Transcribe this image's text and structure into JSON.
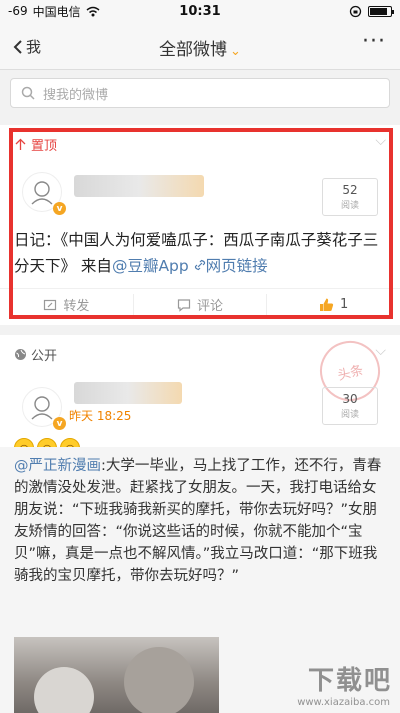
{
  "statusbar": {
    "signal": "-69",
    "carrier": "中国电信",
    "time": "10:31",
    "battery_level": 0.85
  },
  "nav": {
    "back_label": "我",
    "title": "全部微博",
    "title_chevron": "⌄",
    "more": "···"
  },
  "search": {
    "placeholder": "搜我的微博"
  },
  "post1": {
    "tag": "置顶",
    "reads": "52",
    "reads_label": "阅读",
    "text_prefix": "日记：《中国人为何爱嗑瓜子：西瓜子南瓜子葵花子三分天下》 来自",
    "text_source": "@豆瓣App",
    "text_link": "网页链接",
    "repost_label": "转发",
    "comment_label": "评论",
    "like_count": "1"
  },
  "post2": {
    "tag": "公开",
    "time": "昨天 18:25",
    "reads": "30",
    "reads_label": "阅读",
    "stamp": "头条",
    "repost_user": "@严正新漫画",
    "repost_text": ":大学一毕业，马上找了工作，还不行，青春的激情没处发泄。赶紧找了女朋友。一天，我打电话给女朋友说：“下班我骑我新买的摩托，带你去玩好吗？”女朋友矫情的回答：“你说这些话的时候，你就不能加个“宝贝”嘛，真是一点也不解风情。”我立马改口道：“那下班我骑我的宝贝摩托，带你去玩好吗？”"
  },
  "watermark": {
    "main": "下载吧",
    "sub": "www.xiazaiba.com"
  },
  "colors": {
    "highlight": "#e8322e",
    "accent": "#f5a623",
    "link": "#507daf"
  }
}
